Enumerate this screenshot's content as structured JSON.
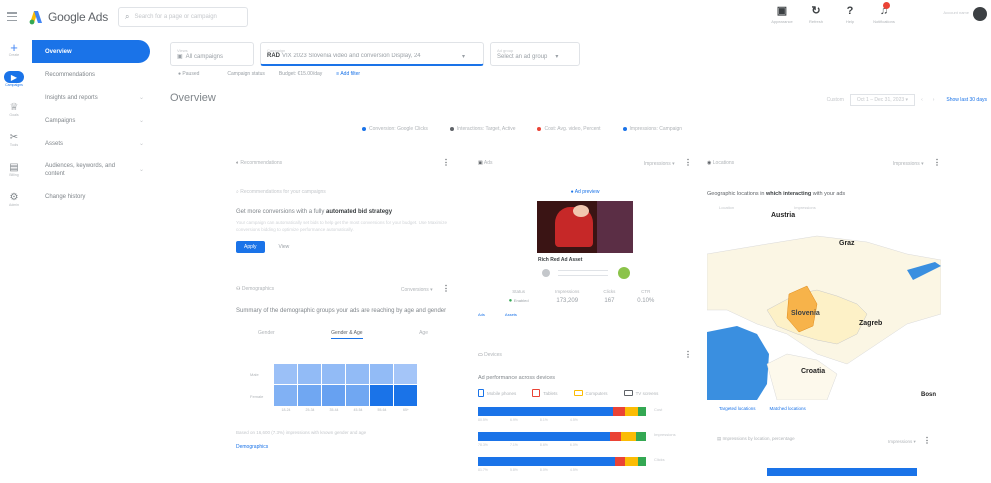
{
  "header": {
    "product": "Google Ads",
    "search_placeholder": "Search for a page or campaign",
    "tools": [
      {
        "icon": "appearance-icon",
        "label": "Appearance"
      },
      {
        "icon": "refresh-icon",
        "label": "Refresh"
      },
      {
        "icon": "help-icon",
        "label": "Help"
      },
      {
        "icon": "notifications-icon",
        "label": "Notifications"
      }
    ],
    "account": "Account name"
  },
  "rail": [
    {
      "icon": "create-icon",
      "glyph": "+",
      "label": "Create"
    },
    {
      "icon": "campaigns-icon",
      "glyph": "▶",
      "label": "Campaigns"
    },
    {
      "icon": "goals-icon",
      "glyph": "🏆",
      "label": "Goals"
    },
    {
      "icon": "tools-icon",
      "glyph": "✕",
      "label": "Tools"
    },
    {
      "icon": "billing-icon",
      "glyph": "▤",
      "label": "Billing"
    },
    {
      "icon": "admin-icon",
      "glyph": "⚙",
      "label": "Admin"
    }
  ],
  "nav": {
    "items": [
      {
        "label": "Overview",
        "active": true
      },
      {
        "label": "Recommendations"
      },
      {
        "label": "Insights and reports",
        "chevron": true
      },
      {
        "label": "Campaigns",
        "chevron": true
      },
      {
        "label": "Assets",
        "chevron": true
      },
      {
        "label": "Audiences, keywords, and content",
        "chevron": true
      },
      {
        "label": "Change history"
      }
    ]
  },
  "filters": {
    "view": {
      "key": "Views",
      "value": "All campaigns"
    },
    "campaign": {
      "key": "Campaign",
      "prefix": "RAD",
      "value": "VIX 2023 Slovenia video and conversion Display, 24"
    },
    "ad_group": {
      "key": "Ad group",
      "value": "Select an ad group"
    },
    "sub": [
      "Paused",
      "Campaign status",
      "Budget: €15.00/day",
      "Add filter"
    ]
  },
  "page": {
    "title": "Overview",
    "date_label": "Custom",
    "date_range": "Oct 1 – Dec 31, 2023",
    "link": "Show last 30 days"
  },
  "metrics_legend": [
    {
      "label": "Conversion: Google Clicks",
      "color": "#1a73e8"
    },
    {
      "label": "Interactions: Target, Active",
      "color": "#5f6368"
    },
    {
      "label": "Cost: Avg. video, Percent",
      "color": "#ea4335"
    },
    {
      "label": "Impressions: Campaign",
      "color": "#1a73e8"
    }
  ],
  "rec_card": {
    "header": "Recommendations",
    "subtitle": "Recommendations for your campaigns",
    "headline_prefix": "Get more conversions with a fully ",
    "headline_bold": "automated bid strategy",
    "body": "Your campaign can automatically set bids to help get the most conversions for your budget. Use Maximize conversions bidding to optimize performance automatically.",
    "apply": "Apply",
    "view": "View"
  },
  "demo_card": {
    "header": "Demographics",
    "dropdown": "Conversions",
    "desc": "Summary of the demographic groups your ads are reaching by age and gender",
    "tabs": [
      "Gender",
      "Gender & Age",
      "Age"
    ],
    "rows": [
      "Male",
      "Female"
    ],
    "cols": [
      "18-24",
      "25-34",
      "35-44",
      "45-54",
      "55-64",
      "65+"
    ],
    "values": [
      [
        0.25,
        0.3,
        0.3,
        0.3,
        0.3,
        0.2
      ],
      [
        0.4,
        0.5,
        0.55,
        0.5,
        1.0,
        1.0
      ]
    ],
    "footnote": "Based on 16,600 (7.3%) impressions with known gender and age",
    "link": "Demographics"
  },
  "ad_card": {
    "header": "Ads",
    "dropdown": "Impressions",
    "preview": "Ad preview",
    "title": "Rich Red Ad Asset",
    "table_headers": [
      "Status",
      "Impressions",
      "Clicks",
      "CTR"
    ],
    "stats": [
      "Enabled",
      "173,209",
      "167",
      "0.10%"
    ],
    "links": [
      "Ads",
      "Assets"
    ]
  },
  "device_card": {
    "header": "Devices",
    "desc": "Ad performance across devices",
    "devices": [
      "Mobile phones",
      "Tablets",
      "Computers",
      "TV screens"
    ],
    "bars": [
      {
        "labels": [
          "80.5%",
          "6.9%",
          "8.1%",
          "4.5%"
        ],
        "note": "Cost"
      },
      {
        "labels": [
          "78.3%",
          "7.1%",
          "8.6%",
          "6.0%"
        ],
        "note": "Impressions"
      },
      {
        "labels": [
          "81.7%",
          "5.8%",
          "8.0%",
          "4.5%"
        ],
        "note": "Clicks"
      }
    ]
  },
  "map_card": {
    "header": "Locations",
    "dropdown": "Impressions",
    "desc_prefix": "Geographic locations in ",
    "desc_bold": "which interacting",
    "desc_suffix": " with your ads",
    "cols": [
      "Location",
      "Impressions"
    ],
    "cities": [
      "Austria",
      "Graz",
      "Slovenia",
      "Zagreb",
      "Croatia",
      "Bosn"
    ],
    "links": [
      "Targeted locations",
      "Matched locations"
    ],
    "select": "Impressions by location, percentage",
    "select_value": "Impressions"
  }
}
